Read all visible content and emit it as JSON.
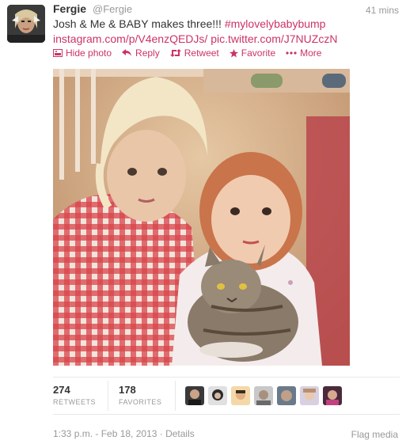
{
  "tweet": {
    "fullname": "Fergie",
    "username": "@Fergie",
    "timestamp": "41 mins",
    "text_plain": "Josh & Me & BABY makes three!!! ",
    "hashtag": "#mylovelybabybump",
    "link1": "instagram.com/p/V4enzQEDJs/",
    "link2": "pic.twitter.com/J7NUZczN"
  },
  "actions": {
    "hide_photo": "Hide photo",
    "reply": "Reply",
    "retweet": "Retweet",
    "favorite": "Favorite",
    "more": "More"
  },
  "stats": {
    "retweets_count": "274",
    "retweets_label": "RETWEETS",
    "favorites_count": "178",
    "favorites_label": "FAVORITES"
  },
  "footer": {
    "meta": "1:33 p.m. - Feb 18, 2013 · Details",
    "flag": "Flag media"
  },
  "colors": {
    "accent": "#cc3366",
    "muted": "#999999",
    "text": "#333333"
  }
}
